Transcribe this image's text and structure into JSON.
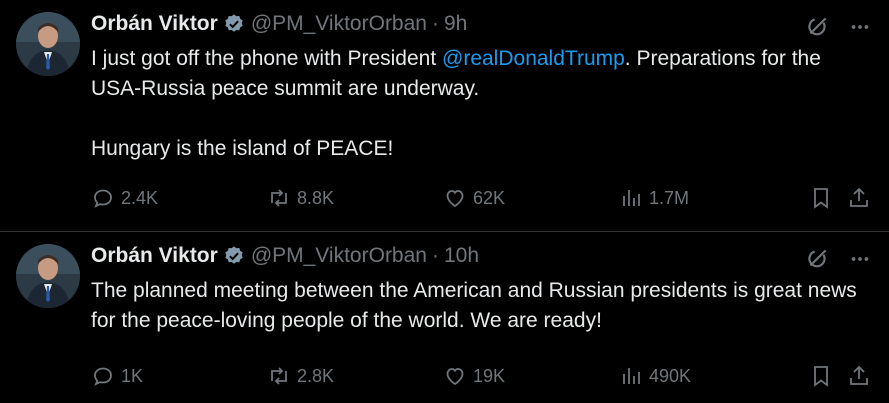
{
  "tweets": [
    {
      "name": "Orbán Viktor",
      "handle": "@PM_ViktorOrban",
      "dot": "·",
      "time": "9h",
      "text_before": "I just got off the phone with President ",
      "mention": "@realDonaldTrump",
      "text_after": ". Preparations for the USA-Russia peace summit are underway.",
      "text_para2": "Hungary is the island of PEACE!",
      "replies": "2.4K",
      "reposts": "8.8K",
      "likes": "62K",
      "views": "1.7M"
    },
    {
      "name": "Orbán Viktor",
      "handle": "@PM_ViktorOrban",
      "dot": "·",
      "time": "10h",
      "text": "The planned meeting between the American and Russian presidents is great news for the peace-loving people of the world. We are ready!",
      "replies": "1K",
      "reposts": "2.8K",
      "likes": "19K",
      "views": "490K"
    }
  ],
  "colors": {
    "background": "#000000",
    "text": "#e7e9ea",
    "muted": "#71767b",
    "link": "#1d9bf0",
    "verified": "#829aab"
  },
  "icons": [
    "verified-badge-icon",
    "grok-icon",
    "more-icon",
    "reply-icon",
    "repost-icon",
    "like-icon",
    "views-icon",
    "bookmark-icon",
    "share-icon"
  ]
}
